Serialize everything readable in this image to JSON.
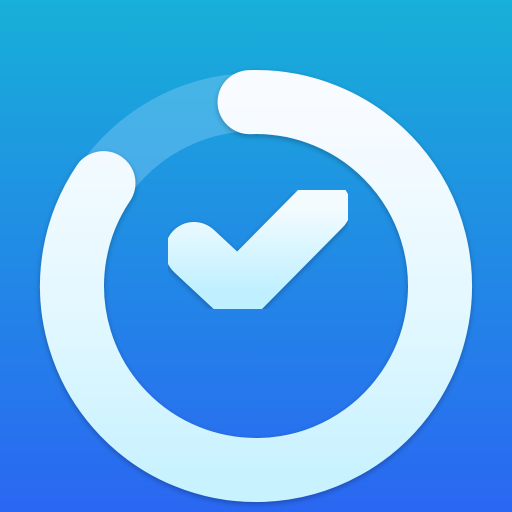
{
  "icon": {
    "name": "progress-check-app-icon",
    "progress_fraction": 0.85,
    "colors": {
      "background_top": "#17b0d8",
      "background_bottom": "#2a67f2",
      "ring_track": "#8fd3f7",
      "ring_fill_light": "#f8fbff",
      "ring_fill_cyan": "#c9f2ff",
      "checkmark_light": "#f3fbff",
      "checkmark_cyan": "#bff0ff"
    }
  }
}
